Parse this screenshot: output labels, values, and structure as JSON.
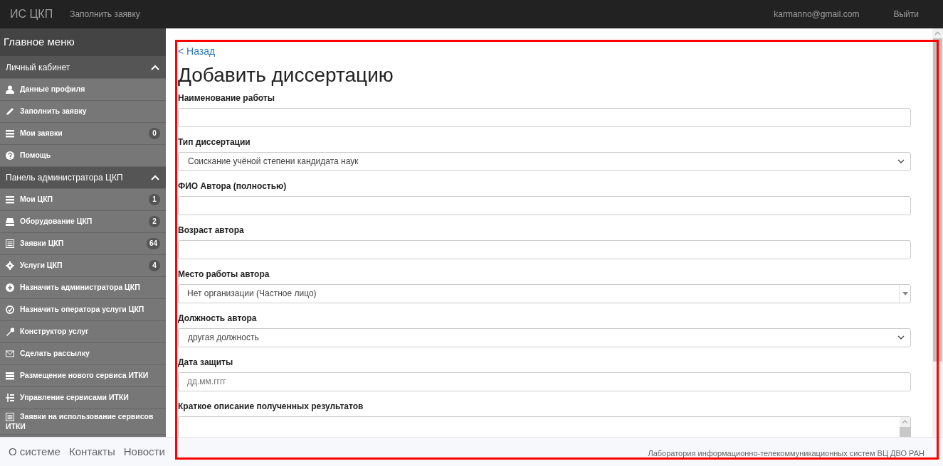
{
  "navbar": {
    "brand": "ИС ЦКП",
    "links": [
      {
        "label": "Заполнить заявку"
      }
    ],
    "user": "karmanno@gmail.com",
    "logout": "Выйти"
  },
  "sidebar": {
    "title": "Главное меню",
    "sections": [
      {
        "title": "Личный кабинет",
        "expanded": true,
        "items": [
          {
            "label": "Данные профиля"
          },
          {
            "label": "Заполнить заявку"
          },
          {
            "label": "Мои заявки",
            "badge": "0"
          },
          {
            "label": "Помощь"
          }
        ]
      },
      {
        "title": "Панель администратора ЦКП",
        "expanded": true,
        "items": [
          {
            "label": "Мои ЦКП",
            "badge": "1"
          },
          {
            "label": "Оборудование ЦКП",
            "badge": "2"
          },
          {
            "label": "Заявки ЦКП",
            "badge": "64"
          },
          {
            "label": "Услуги ЦКП",
            "badge": "4"
          },
          {
            "label": "Назначить администратора ЦКП"
          },
          {
            "label": "Назначить оператора услуги ЦКП"
          },
          {
            "label": "Конструктор услуг"
          },
          {
            "label": "Сделать рассылку"
          },
          {
            "label": "Размещение нового сервиса ИТКИ"
          },
          {
            "label": "Управление сервисами ИТКИ"
          },
          {
            "label": "Заявки на использование сервисов ИТКИ"
          }
        ]
      }
    ]
  },
  "page": {
    "back": "< Назад",
    "title": "Добавить диссертацию",
    "fields": [
      {
        "kind": "text",
        "label": "Наименование работы"
      },
      {
        "kind": "select",
        "label": "Тип диссертации",
        "value": "Соискание учёной степени кандидата наук"
      },
      {
        "kind": "text",
        "label": "ФИО Автора (полностью)"
      },
      {
        "kind": "text",
        "label": "Возраст автора"
      },
      {
        "kind": "combo",
        "label": "Место работы автора",
        "value": "Нет организации (Частное лицо)"
      },
      {
        "kind": "select",
        "label": "Должность автора",
        "value": "другая должность"
      },
      {
        "kind": "date",
        "label": "Дата защиты",
        "placeholder": "дд.мм.гггг"
      },
      {
        "kind": "textarea",
        "label": "Краткое описание полученных результатов"
      }
    ]
  },
  "footer": {
    "links": [
      {
        "label": "О системе"
      },
      {
        "label": "Контакты"
      },
      {
        "label": "Новости"
      }
    ],
    "credit": "Лаборатория информационно-телекоммуникационных систем ВЦ ДВО РАН"
  },
  "highlight_frame": true
}
